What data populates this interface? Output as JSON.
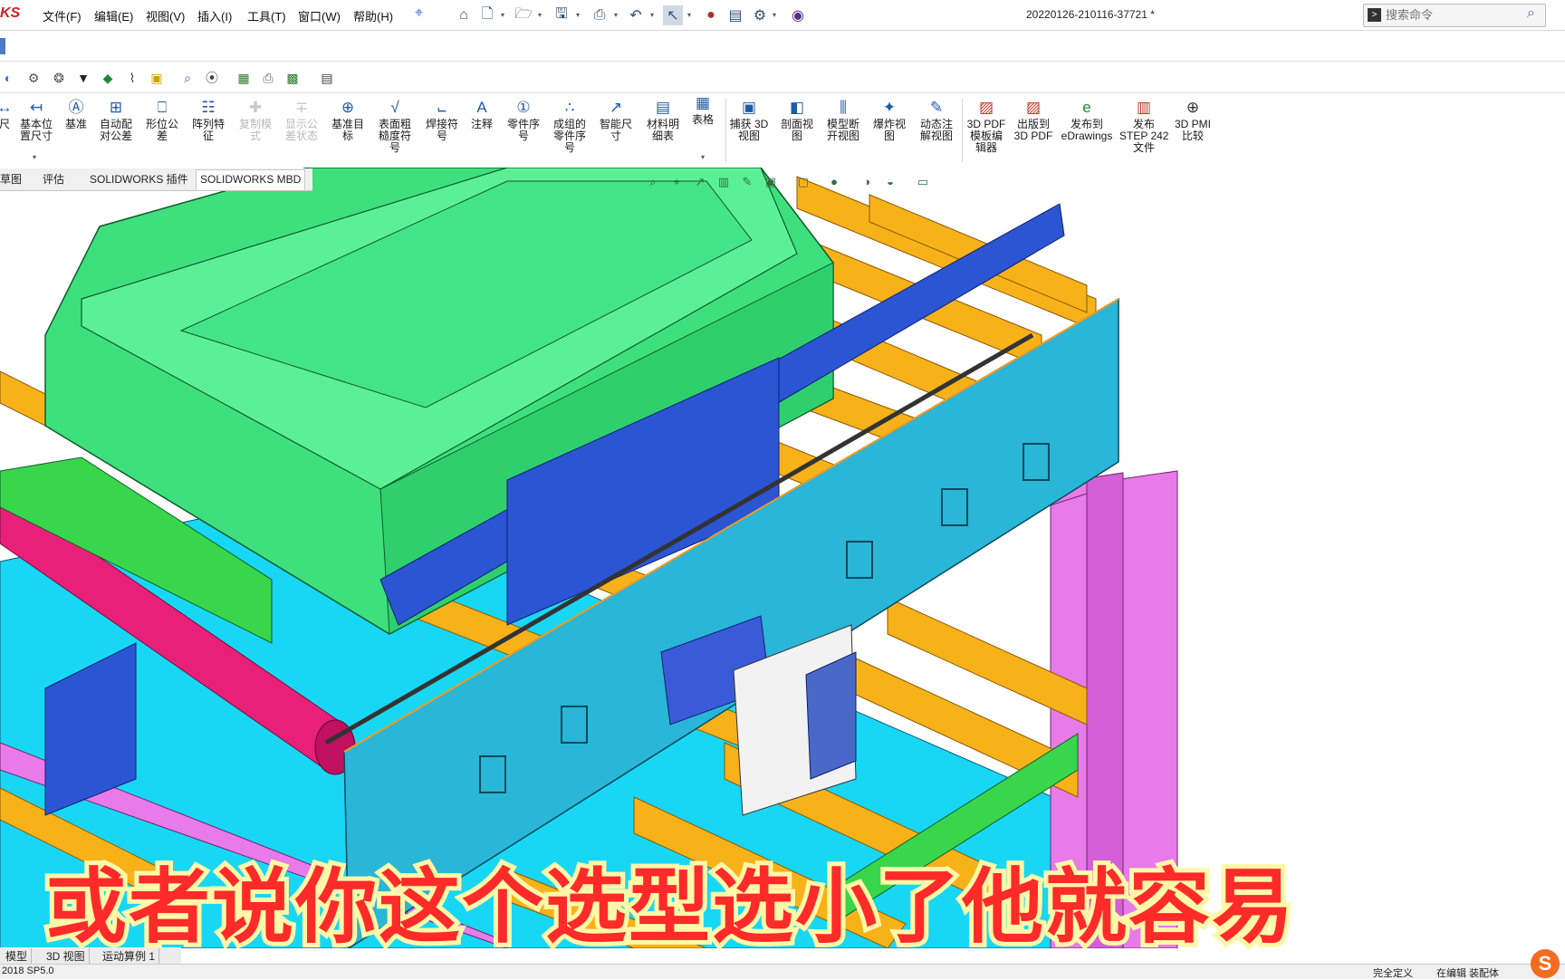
{
  "app": {
    "logo_fragment": "KS",
    "doc_title": "20220126-210116-37721 *"
  },
  "menu": [
    {
      "label": "文件(F)"
    },
    {
      "label": "编辑(E)"
    },
    {
      "label": "视图(V)"
    },
    {
      "label": "插入(I)"
    },
    {
      "label": "工具(T)"
    },
    {
      "label": "窗口(W)"
    },
    {
      "label": "帮助(H)"
    }
  ],
  "search": {
    "placeholder": "搜索命令"
  },
  "quick_access_icons": [
    "home-icon",
    "new-icon",
    "open-icon",
    "save-icon",
    "print-icon",
    "undo-icon",
    "select-icon",
    "traffic-light-icon",
    "file-props-icon",
    "options-icon",
    "sw-resources-icon"
  ],
  "command_manager": [
    {
      "label": "尺\n",
      "icon": "dimension-icon",
      "enabled": true
    },
    {
      "label": "基本位\n置尺寸",
      "icon": "basic-location-dim-icon",
      "enabled": true
    },
    {
      "label": "基准",
      "icon": "datum-icon",
      "enabled": true
    },
    {
      "label": "自动配\n对公差",
      "icon": "auto-pair-tolerance-icon",
      "enabled": true
    },
    {
      "label": "形位公\n差",
      "icon": "geometric-tolerance-icon",
      "enabled": true
    },
    {
      "label": "阵列特\n征",
      "icon": "pattern-feature-icon",
      "enabled": true
    },
    {
      "label": "复制模\n式",
      "icon": "copy-scheme-icon",
      "enabled": false
    },
    {
      "label": "显示公\n差状态",
      "icon": "show-tolerance-status-icon",
      "enabled": false
    },
    {
      "label": "基准目\n标",
      "icon": "datum-target-icon",
      "enabled": true
    },
    {
      "label": "表面粗\n糙度符\n号",
      "icon": "surface-finish-icon",
      "enabled": true
    },
    {
      "label": "焊接符\n号",
      "icon": "weld-symbol-icon",
      "enabled": true
    },
    {
      "label": "注释",
      "icon": "note-icon",
      "enabled": true
    },
    {
      "label": "零件序\n号",
      "icon": "balloon-icon",
      "enabled": true
    },
    {
      "label": "成组的\n零件序\n号",
      "icon": "stacked-balloon-icon",
      "enabled": true
    },
    {
      "label": "智能尺\n寸",
      "icon": "smart-dimension-icon",
      "enabled": true
    },
    {
      "label": "材料明\n细表",
      "icon": "bom-icon",
      "enabled": true
    },
    {
      "label": "表格",
      "icon": "table-icon",
      "enabled": true
    },
    {
      "label": "捕获 3D\n视图",
      "icon": "capture-3d-view-icon",
      "enabled": true
    },
    {
      "label": "剖面视\n图",
      "icon": "section-view-icon",
      "enabled": true
    },
    {
      "label": "模型断\n开视图",
      "icon": "model-break-view-icon",
      "enabled": true
    },
    {
      "label": "爆炸视\n图",
      "icon": "exploded-view-icon",
      "enabled": true
    },
    {
      "label": "动态注\n解视图",
      "icon": "dynamic-annotation-icon",
      "enabled": true
    },
    {
      "label": "3D PDF\n模板编\n辑器",
      "icon": "3d-pdf-template-icon",
      "enabled": true
    },
    {
      "label": "出版到\n3D PDF",
      "icon": "publish-3d-pdf-icon",
      "enabled": true
    },
    {
      "label": "发布到\neDrawings",
      "icon": "edrawings-icon",
      "enabled": true
    },
    {
      "label": "发布\nSTEP 242\n文件",
      "icon": "step242-icon",
      "enabled": true
    },
    {
      "label": "3D PMI\n比较",
      "icon": "pmi-compare-icon",
      "enabled": true
    }
  ],
  "tabs": [
    {
      "label": "草图"
    },
    {
      "label": "评估"
    },
    {
      "label": "SOLIDWORKS 插件"
    },
    {
      "label": "SOLIDWORKS MBD"
    }
  ],
  "bottom_tabs": [
    {
      "label": "模型"
    },
    {
      "label": "3D 视图"
    },
    {
      "label": "运动算例 1"
    }
  ],
  "status": {
    "version": "2018 SP5.0",
    "definition": "完全定义",
    "editing": "在编辑 装配体"
  },
  "subtitle": "或者说你这个选型选小了他就容易",
  "colors": {
    "part_green": "#3ee07e",
    "frame_cyan": "#18d7f5",
    "side_plate": "#2ab6d6",
    "bracket_blue": "#2c55d4",
    "roller_orange": "#f7b21a",
    "extrusion_pink": "#e87ae9",
    "shaft_pink": "#e8207a",
    "subtitle_red": "#ff2a2a"
  }
}
